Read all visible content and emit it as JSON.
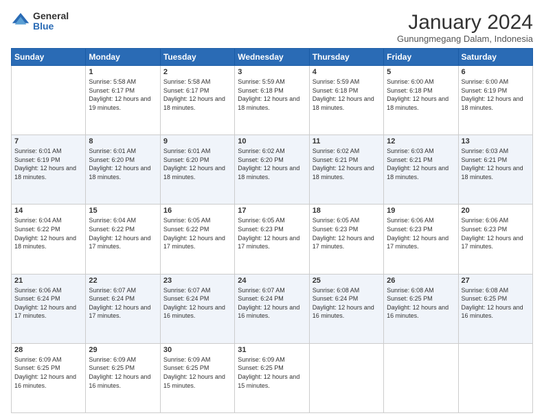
{
  "logo": {
    "general": "General",
    "blue": "Blue"
  },
  "header": {
    "title": "January 2024",
    "subtitle": "Gunungmegang Dalam, Indonesia"
  },
  "weekdays": [
    "Sunday",
    "Monday",
    "Tuesday",
    "Wednesday",
    "Thursday",
    "Friday",
    "Saturday"
  ],
  "weeks": [
    [
      {
        "day": "",
        "sunrise": "",
        "sunset": "",
        "daylight": ""
      },
      {
        "day": "1",
        "sunrise": "Sunrise: 5:58 AM",
        "sunset": "Sunset: 6:17 PM",
        "daylight": "Daylight: 12 hours and 19 minutes."
      },
      {
        "day": "2",
        "sunrise": "Sunrise: 5:58 AM",
        "sunset": "Sunset: 6:17 PM",
        "daylight": "Daylight: 12 hours and 18 minutes."
      },
      {
        "day": "3",
        "sunrise": "Sunrise: 5:59 AM",
        "sunset": "Sunset: 6:18 PM",
        "daylight": "Daylight: 12 hours and 18 minutes."
      },
      {
        "day": "4",
        "sunrise": "Sunrise: 5:59 AM",
        "sunset": "Sunset: 6:18 PM",
        "daylight": "Daylight: 12 hours and 18 minutes."
      },
      {
        "day": "5",
        "sunrise": "Sunrise: 6:00 AM",
        "sunset": "Sunset: 6:18 PM",
        "daylight": "Daylight: 12 hours and 18 minutes."
      },
      {
        "day": "6",
        "sunrise": "Sunrise: 6:00 AM",
        "sunset": "Sunset: 6:19 PM",
        "daylight": "Daylight: 12 hours and 18 minutes."
      }
    ],
    [
      {
        "day": "7",
        "sunrise": "Sunrise: 6:01 AM",
        "sunset": "Sunset: 6:19 PM",
        "daylight": "Daylight: 12 hours and 18 minutes."
      },
      {
        "day": "8",
        "sunrise": "Sunrise: 6:01 AM",
        "sunset": "Sunset: 6:20 PM",
        "daylight": "Daylight: 12 hours and 18 minutes."
      },
      {
        "day": "9",
        "sunrise": "Sunrise: 6:01 AM",
        "sunset": "Sunset: 6:20 PM",
        "daylight": "Daylight: 12 hours and 18 minutes."
      },
      {
        "day": "10",
        "sunrise": "Sunrise: 6:02 AM",
        "sunset": "Sunset: 6:20 PM",
        "daylight": "Daylight: 12 hours and 18 minutes."
      },
      {
        "day": "11",
        "sunrise": "Sunrise: 6:02 AM",
        "sunset": "Sunset: 6:21 PM",
        "daylight": "Daylight: 12 hours and 18 minutes."
      },
      {
        "day": "12",
        "sunrise": "Sunrise: 6:03 AM",
        "sunset": "Sunset: 6:21 PM",
        "daylight": "Daylight: 12 hours and 18 minutes."
      },
      {
        "day": "13",
        "sunrise": "Sunrise: 6:03 AM",
        "sunset": "Sunset: 6:21 PM",
        "daylight": "Daylight: 12 hours and 18 minutes."
      }
    ],
    [
      {
        "day": "14",
        "sunrise": "Sunrise: 6:04 AM",
        "sunset": "Sunset: 6:22 PM",
        "daylight": "Daylight: 12 hours and 18 minutes."
      },
      {
        "day": "15",
        "sunrise": "Sunrise: 6:04 AM",
        "sunset": "Sunset: 6:22 PM",
        "daylight": "Daylight: 12 hours and 17 minutes."
      },
      {
        "day": "16",
        "sunrise": "Sunrise: 6:05 AM",
        "sunset": "Sunset: 6:22 PM",
        "daylight": "Daylight: 12 hours and 17 minutes."
      },
      {
        "day": "17",
        "sunrise": "Sunrise: 6:05 AM",
        "sunset": "Sunset: 6:23 PM",
        "daylight": "Daylight: 12 hours and 17 minutes."
      },
      {
        "day": "18",
        "sunrise": "Sunrise: 6:05 AM",
        "sunset": "Sunset: 6:23 PM",
        "daylight": "Daylight: 12 hours and 17 minutes."
      },
      {
        "day": "19",
        "sunrise": "Sunrise: 6:06 AM",
        "sunset": "Sunset: 6:23 PM",
        "daylight": "Daylight: 12 hours and 17 minutes."
      },
      {
        "day": "20",
        "sunrise": "Sunrise: 6:06 AM",
        "sunset": "Sunset: 6:23 PM",
        "daylight": "Daylight: 12 hours and 17 minutes."
      }
    ],
    [
      {
        "day": "21",
        "sunrise": "Sunrise: 6:06 AM",
        "sunset": "Sunset: 6:24 PM",
        "daylight": "Daylight: 12 hours and 17 minutes."
      },
      {
        "day": "22",
        "sunrise": "Sunrise: 6:07 AM",
        "sunset": "Sunset: 6:24 PM",
        "daylight": "Daylight: 12 hours and 17 minutes."
      },
      {
        "day": "23",
        "sunrise": "Sunrise: 6:07 AM",
        "sunset": "Sunset: 6:24 PM",
        "daylight": "Daylight: 12 hours and 16 minutes."
      },
      {
        "day": "24",
        "sunrise": "Sunrise: 6:07 AM",
        "sunset": "Sunset: 6:24 PM",
        "daylight": "Daylight: 12 hours and 16 minutes."
      },
      {
        "day": "25",
        "sunrise": "Sunrise: 6:08 AM",
        "sunset": "Sunset: 6:24 PM",
        "daylight": "Daylight: 12 hours and 16 minutes."
      },
      {
        "day": "26",
        "sunrise": "Sunrise: 6:08 AM",
        "sunset": "Sunset: 6:25 PM",
        "daylight": "Daylight: 12 hours and 16 minutes."
      },
      {
        "day": "27",
        "sunrise": "Sunrise: 6:08 AM",
        "sunset": "Sunset: 6:25 PM",
        "daylight": "Daylight: 12 hours and 16 minutes."
      }
    ],
    [
      {
        "day": "28",
        "sunrise": "Sunrise: 6:09 AM",
        "sunset": "Sunset: 6:25 PM",
        "daylight": "Daylight: 12 hours and 16 minutes."
      },
      {
        "day": "29",
        "sunrise": "Sunrise: 6:09 AM",
        "sunset": "Sunset: 6:25 PM",
        "daylight": "Daylight: 12 hours and 16 minutes."
      },
      {
        "day": "30",
        "sunrise": "Sunrise: 6:09 AM",
        "sunset": "Sunset: 6:25 PM",
        "daylight": "Daylight: 12 hours and 15 minutes."
      },
      {
        "day": "31",
        "sunrise": "Sunrise: 6:09 AM",
        "sunset": "Sunset: 6:25 PM",
        "daylight": "Daylight: 12 hours and 15 minutes."
      },
      {
        "day": "",
        "sunrise": "",
        "sunset": "",
        "daylight": ""
      },
      {
        "day": "",
        "sunrise": "",
        "sunset": "",
        "daylight": ""
      },
      {
        "day": "",
        "sunrise": "",
        "sunset": "",
        "daylight": ""
      }
    ]
  ]
}
